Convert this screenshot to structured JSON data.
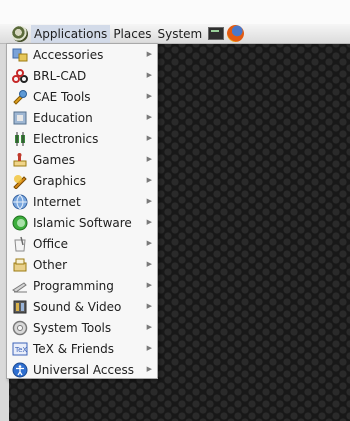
{
  "panel": {
    "menus": [
      {
        "label": "Applications",
        "active": true
      },
      {
        "label": "Places",
        "active": false
      },
      {
        "label": "System",
        "active": false
      }
    ],
    "launchers": [
      "terminal-icon",
      "firefox-icon"
    ]
  },
  "menu": {
    "items": [
      {
        "label": "Accessories",
        "icon": "accessories-icon",
        "color": "#5b86c4"
      },
      {
        "label": "BRL-CAD",
        "icon": "brl-cad-icon",
        "color": "#c62828"
      },
      {
        "label": "CAE Tools",
        "icon": "cae-tools-icon",
        "color": "#e0a020"
      },
      {
        "label": "Education",
        "icon": "education-icon",
        "color": "#6f8fb3"
      },
      {
        "label": "Electronics",
        "icon": "electronics-icon",
        "color": "#3a8a3a"
      },
      {
        "label": "Games",
        "icon": "games-icon",
        "color": "#c0392b"
      },
      {
        "label": "Graphics",
        "icon": "graphics-icon",
        "color": "#d98b1a"
      },
      {
        "label": "Internet",
        "icon": "internet-icon",
        "color": "#4f7fbf"
      },
      {
        "label": "Islamic Software",
        "icon": "islamic-software-icon",
        "color": "#3cae3c"
      },
      {
        "label": "Office",
        "icon": "office-icon",
        "color": "#9a9a9a"
      },
      {
        "label": "Other",
        "icon": "other-icon",
        "color": "#caa54a"
      },
      {
        "label": "Programming",
        "icon": "programming-icon",
        "color": "#8c8c8c"
      },
      {
        "label": "Sound & Video",
        "icon": "sound-video-icon",
        "color": "#6a6a6a"
      },
      {
        "label": "System Tools",
        "icon": "system-tools-icon",
        "color": "#8a8a8a"
      },
      {
        "label": "TeX & Friends",
        "icon": "tex-friends-icon",
        "color": "#3d63b8"
      },
      {
        "label": "Universal Access",
        "icon": "universal-access-icon",
        "color": "#2f6fd0"
      }
    ]
  }
}
